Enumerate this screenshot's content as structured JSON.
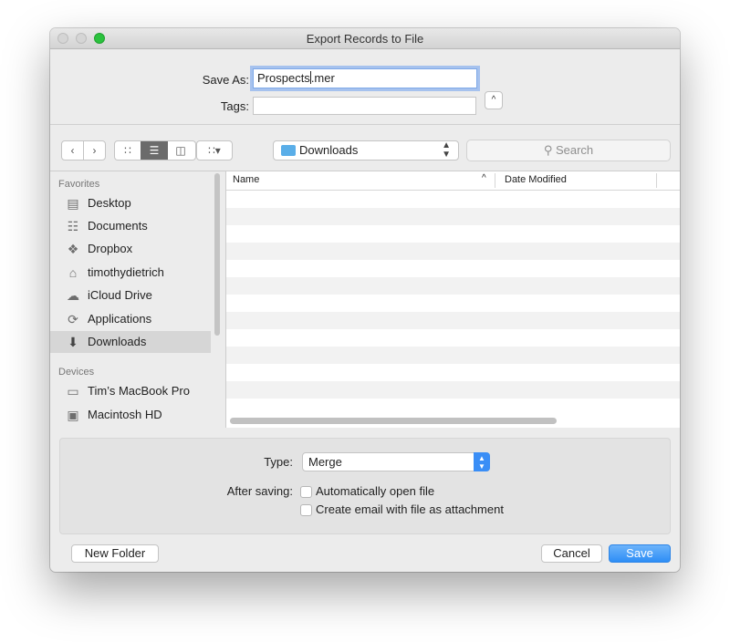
{
  "window": {
    "title": "Export Records to File"
  },
  "save": {
    "save_as_label": "Save As:",
    "filename_before_cursor": "Prospects",
    "filename_after_cursor": ".mer",
    "tags_label": "Tags:",
    "tags_value": "",
    "expand_glyph": "^"
  },
  "toolbar": {
    "location": "Downloads",
    "search_placeholder": "Search"
  },
  "sidebar": {
    "favorites_header": "Favorites",
    "favorites": [
      {
        "label": "Desktop",
        "icon": "desktop-icon"
      },
      {
        "label": "Documents",
        "icon": "documents-icon"
      },
      {
        "label": "Dropbox",
        "icon": "dropbox-icon"
      },
      {
        "label": "timothydietrich",
        "icon": "home-icon"
      },
      {
        "label": "iCloud Drive",
        "icon": "cloud-icon"
      },
      {
        "label": "Applications",
        "icon": "applications-icon"
      },
      {
        "label": "Downloads",
        "icon": "downloads-icon",
        "selected": true
      }
    ],
    "devices_header": "Devices",
    "devices": [
      {
        "label": "Tim’s MacBook Pro",
        "icon": "laptop-icon"
      },
      {
        "label": "Macintosh HD",
        "icon": "harddisk-icon"
      }
    ]
  },
  "filelist": {
    "col_name": "Name",
    "col_date": "Date Modified",
    "sort_glyph": "^",
    "rows": []
  },
  "options": {
    "type_label": "Type:",
    "type_value": "Merge",
    "after_saving_label": "After saving:",
    "checkbox_open": {
      "label": "Automatically open file",
      "checked": false
    },
    "checkbox_email": {
      "label": "Create email with file as attachment",
      "checked": false
    }
  },
  "buttons": {
    "new_folder": "New Folder",
    "cancel": "Cancel",
    "save": "Save"
  },
  "colors": {
    "accent": "#2e8ef6",
    "selection": "#d6d6d6",
    "focus_ring": "#6ea0f0",
    "maximize": "#2bc23e"
  }
}
